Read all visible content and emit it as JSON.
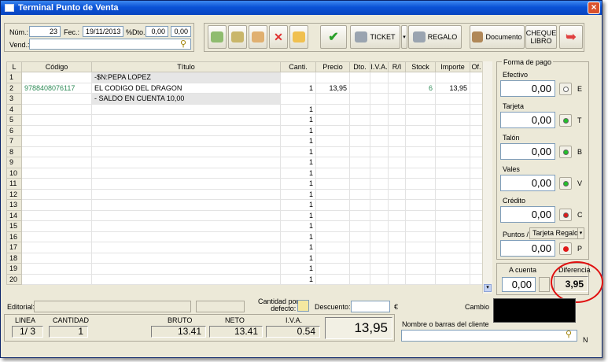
{
  "window": {
    "title": "Terminal Punto de Venta",
    "close": "×"
  },
  "header": {
    "num_label": "Núm.:",
    "num_value": "23",
    "fec_label": "Fec.:",
    "fec_value": "19/11/2013",
    "dto_label": "%Dto.:",
    "dto_value": "0,00",
    "dto_value2": "0,00",
    "vend_label": "Vend.:",
    "vend_value": ""
  },
  "toolbar": {
    "ticket": "TICKET",
    "regalo": "REGALO",
    "documento": "Documento",
    "cheque1": "CHEQUE",
    "cheque2": "LIBRO"
  },
  "grid": {
    "headers": [
      "L",
      "Código",
      "Título",
      "Canti.",
      "Precio",
      "Dto.",
      "I.V.A.",
      "R/I",
      "Stock",
      "Importe",
      "Of."
    ],
    "rows": [
      {
        "l": "1",
        "codigo": "",
        "titulo": "-$N:PEPA LOPEZ",
        "canti": "",
        "precio": "",
        "dto": "",
        "iva": "",
        "ri": "",
        "stock": "",
        "importe": "",
        "of": ""
      },
      {
        "l": "2",
        "codigo": "9788408076117",
        "titulo": "EL CODIGO DEL DRAGON",
        "canti": "1",
        "precio": "13,95",
        "dto": "",
        "iva": "",
        "ri": "",
        "stock": "6",
        "importe": "13,95",
        "of": ""
      },
      {
        "l": "3",
        "codigo": "",
        "titulo": "- SALDO EN CUENTA 10,00",
        "canti": "",
        "precio": "",
        "dto": "",
        "iva": "",
        "ri": "",
        "stock": "",
        "importe": "",
        "of": ""
      },
      {
        "l": "4",
        "codigo": "",
        "titulo": "",
        "canti": "1",
        "precio": "",
        "dto": "",
        "iva": "",
        "ri": "",
        "stock": "",
        "importe": "",
        "of": ""
      },
      {
        "l": "5",
        "codigo": "",
        "titulo": "",
        "canti": "1",
        "precio": "",
        "dto": "",
        "iva": "",
        "ri": "",
        "stock": "",
        "importe": "",
        "of": ""
      },
      {
        "l": "6",
        "codigo": "",
        "titulo": "",
        "canti": "1",
        "precio": "",
        "dto": "",
        "iva": "",
        "ri": "",
        "stock": "",
        "importe": "",
        "of": ""
      },
      {
        "l": "7",
        "codigo": "",
        "titulo": "",
        "canti": "1",
        "precio": "",
        "dto": "",
        "iva": "",
        "ri": "",
        "stock": "",
        "importe": "",
        "of": ""
      },
      {
        "l": "8",
        "codigo": "",
        "titulo": "",
        "canti": "1",
        "precio": "",
        "dto": "",
        "iva": "",
        "ri": "",
        "stock": "",
        "importe": "",
        "of": ""
      },
      {
        "l": "9",
        "codigo": "",
        "titulo": "",
        "canti": "1",
        "precio": "",
        "dto": "",
        "iva": "",
        "ri": "",
        "stock": "",
        "importe": "",
        "of": ""
      },
      {
        "l": "10",
        "codigo": "",
        "titulo": "",
        "canti": "1",
        "precio": "",
        "dto": "",
        "iva": "",
        "ri": "",
        "stock": "",
        "importe": "",
        "of": ""
      },
      {
        "l": "11",
        "codigo": "",
        "titulo": "",
        "canti": "1",
        "precio": "",
        "dto": "",
        "iva": "",
        "ri": "",
        "stock": "",
        "importe": "",
        "of": ""
      },
      {
        "l": "12",
        "codigo": "",
        "titulo": "",
        "canti": "1",
        "precio": "",
        "dto": "",
        "iva": "",
        "ri": "",
        "stock": "",
        "importe": "",
        "of": ""
      },
      {
        "l": "13",
        "codigo": "",
        "titulo": "",
        "canti": "1",
        "precio": "",
        "dto": "",
        "iva": "",
        "ri": "",
        "stock": "",
        "importe": "",
        "of": ""
      },
      {
        "l": "14",
        "codigo": "",
        "titulo": "",
        "canti": "1",
        "precio": "",
        "dto": "",
        "iva": "",
        "ri": "",
        "stock": "",
        "importe": "",
        "of": ""
      },
      {
        "l": "15",
        "codigo": "",
        "titulo": "",
        "canti": "1",
        "precio": "",
        "dto": "",
        "iva": "",
        "ri": "",
        "stock": "",
        "importe": "",
        "of": ""
      },
      {
        "l": "16",
        "codigo": "",
        "titulo": "",
        "canti": "1",
        "precio": "",
        "dto": "",
        "iva": "",
        "ri": "",
        "stock": "",
        "importe": "",
        "of": ""
      },
      {
        "l": "17",
        "codigo": "",
        "titulo": "",
        "canti": "1",
        "precio": "",
        "dto": "",
        "iva": "",
        "ri": "",
        "stock": "",
        "importe": "",
        "of": ""
      },
      {
        "l": "18",
        "codigo": "",
        "titulo": "",
        "canti": "1",
        "precio": "",
        "dto": "",
        "iva": "",
        "ri": "",
        "stock": "",
        "importe": "",
        "of": ""
      },
      {
        "l": "19",
        "codigo": "",
        "titulo": "",
        "canti": "1",
        "precio": "",
        "dto": "",
        "iva": "",
        "ri": "",
        "stock": "",
        "importe": "",
        "of": ""
      },
      {
        "l": "20",
        "codigo": "",
        "titulo": "",
        "canti": "1",
        "precio": "",
        "dto": "",
        "iva": "",
        "ri": "",
        "stock": "",
        "importe": "",
        "of": ""
      }
    ]
  },
  "payment": {
    "legend": "Forma de pago",
    "methods": [
      {
        "label": "Efectivo",
        "value": "0,00",
        "letter": "E",
        "dot": "#ffffff"
      },
      {
        "label": "Tarjeta",
        "value": "0,00",
        "letter": "T",
        "dot": "#22c02a"
      },
      {
        "label": "Talón",
        "value": "0,00",
        "letter": "B",
        "dot": "#22c02a"
      },
      {
        "label": "Vales",
        "value": "0,00",
        "letter": "V",
        "dot": "#22c02a"
      },
      {
        "label": "Crédito",
        "value": "0,00",
        "letter": "C",
        "dot": "#e01818"
      }
    ],
    "puntos_label": "Puntos /",
    "puntos_select": "Tarjeta Regalo",
    "puntos_value": "0,00",
    "puntos_letter": "P",
    "puntos_dot": "#e01818",
    "a_cuenta_label": "A cuenta",
    "a_cuenta_value": "0,00",
    "diferencia_label": "Diferencia",
    "diferencia_value": "3,95"
  },
  "footer": {
    "editorial_label": "Editorial:",
    "cantidad_defecto_label1": "Cantidad por",
    "cantidad_defecto_label2": "defecto:",
    "descuento_label": "Descuento:",
    "currency": "€",
    "cambio_label": "Cambio",
    "linea_label": "LINEA",
    "linea_value": "1/ 3",
    "cantidad_label": "CANTIDAD",
    "cantidad_value": "1",
    "bruto_label": "BRUTO",
    "bruto_value": "13.41",
    "neto_label": "NETO",
    "neto_value": "13.41",
    "iva_label": "I.V.A.",
    "iva_value": "0.54",
    "total_value": "13,95",
    "cliente_label": "Nombre o barras del cliente",
    "cliente_value": "",
    "n_letter": "N"
  },
  "colors": {
    "highlight_circle": "#e01010",
    "green_text": "#2e8b57"
  }
}
